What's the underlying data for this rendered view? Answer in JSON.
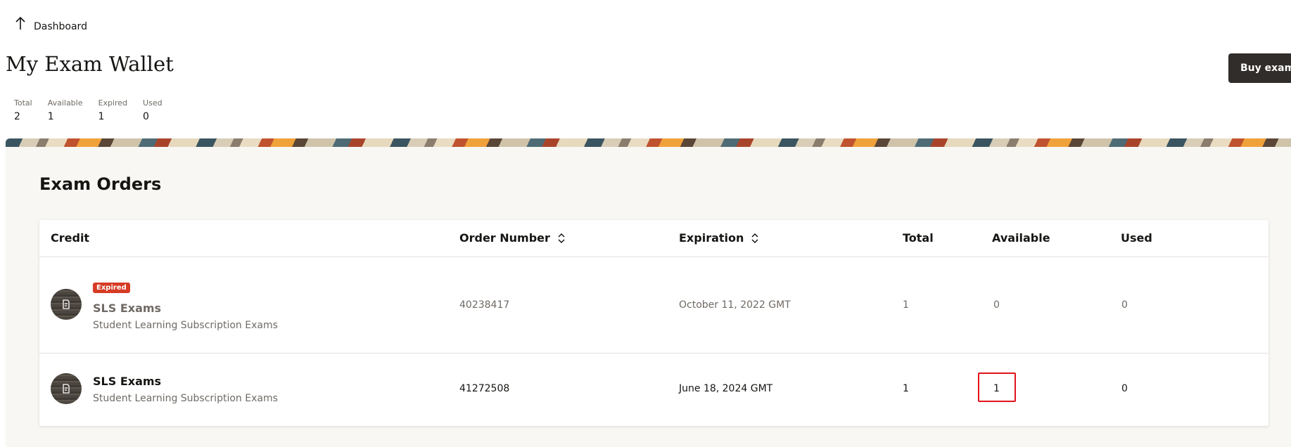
{
  "breadcrumb": {
    "label": "Dashboard",
    "icon": "arrow-up-icon"
  },
  "page": {
    "title": "My Exam Wallet"
  },
  "actions": {
    "buy_exam": "Buy exam"
  },
  "stats": [
    {
      "label": "Total",
      "value": "2"
    },
    {
      "label": "Available",
      "value": "1"
    },
    {
      "label": "Expired",
      "value": "1"
    },
    {
      "label": "Used",
      "value": "0"
    }
  ],
  "section": {
    "title": "Exam Orders"
  },
  "table": {
    "columns": [
      "Credit",
      "Order Number",
      "Expiration",
      "Total",
      "Available",
      "Used"
    ],
    "rows": [
      {
        "badge": "Expired",
        "name": "SLS Exams",
        "description": "Student Learning Subscription Exams",
        "order_number": "40238417",
        "expiration": "October 11, 2022 GMT",
        "total": "1",
        "available": "0",
        "used": "0"
      },
      {
        "badge": "",
        "name": "SLS Exams",
        "description": "Student Learning Subscription Exams",
        "order_number": "41272508",
        "expiration": "June 18, 2024 GMT",
        "total": "1",
        "available": "1",
        "used": "0"
      }
    ]
  },
  "colors": {
    "expired_badge": "#d63b25",
    "buy_button": "#312d2a",
    "highlight": "#e2121b"
  }
}
